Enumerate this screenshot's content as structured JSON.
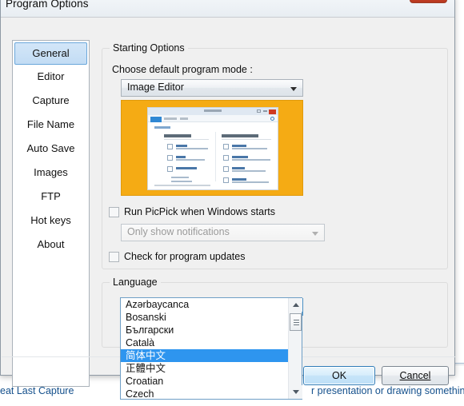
{
  "background_window": {
    "left_link": "eat Last Capture",
    "right_link": "r presentation or drawing something"
  },
  "dialog": {
    "title": "Program Options",
    "close_button": {
      "name": "close-button",
      "glyph": "✕"
    }
  },
  "sidebar": {
    "items": [
      {
        "label": "General",
        "selected": true
      },
      {
        "label": "Editor",
        "selected": false
      },
      {
        "label": "Capture",
        "selected": false
      },
      {
        "label": "File Name",
        "selected": false
      },
      {
        "label": "Auto Save",
        "selected": false
      },
      {
        "label": "Images",
        "selected": false
      },
      {
        "label": "FTP",
        "selected": false
      },
      {
        "label": "Hot keys",
        "selected": false
      },
      {
        "label": "About",
        "selected": false
      }
    ]
  },
  "starting_options": {
    "group_title": "Starting Options",
    "mode_label": "Choose default program mode :",
    "mode_value": "Image Editor",
    "run_at_startup": {
      "label": "Run PicPick when Windows starts",
      "checked": false
    },
    "notification_value": "Only show notifications",
    "check_updates": {
      "label": "Check for program updates",
      "checked": false
    }
  },
  "language_section": {
    "group_title": "Language",
    "selected_value": "简体中文",
    "options": [
      {
        "label": "Azərbaycanca",
        "selected": false
      },
      {
        "label": "Bosanski",
        "selected": false
      },
      {
        "label": "Български",
        "selected": false
      },
      {
        "label": "Català",
        "selected": false
      },
      {
        "label": "简体中文",
        "selected": true
      },
      {
        "label": "正體中文",
        "selected": false
      },
      {
        "label": "Croatian",
        "selected": false
      },
      {
        "label": "Czech",
        "selected": false
      }
    ]
  },
  "footer": {
    "ok_label": "OK",
    "cancel_label": "Cancel"
  },
  "colors": {
    "accent_blue": "#2e95ef",
    "selection_blue": "#c2dcf4",
    "preview_orange": "#f5ab14",
    "close_red": "#c8452c",
    "link_blue": "#14508c"
  }
}
